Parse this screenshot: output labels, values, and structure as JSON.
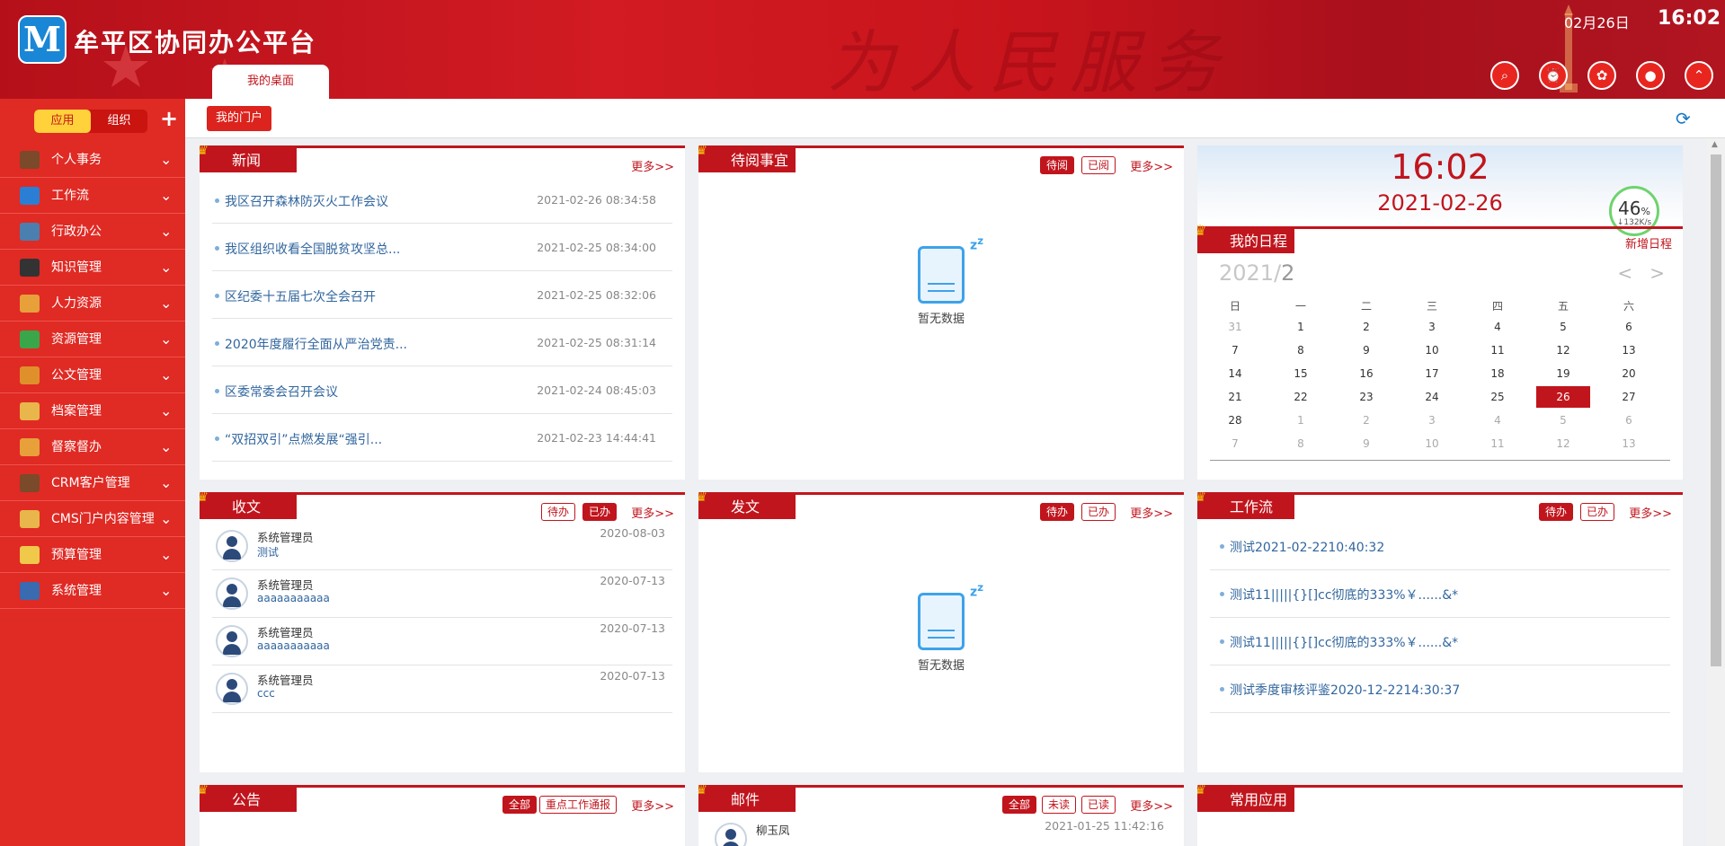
{
  "header": {
    "logo_letter": "M",
    "app_title": "牟平区协同办公平台",
    "tab_label": "我的桌面",
    "background_text": "为人民服务",
    "date": "02月26日",
    "time": "16:02",
    "buttons": [
      "search-icon",
      "alarm-icon",
      "skin-icon",
      "user-icon",
      "collapse-icon"
    ]
  },
  "sidebar": {
    "seg_apps": "应用",
    "seg_org": "组织",
    "add": "+",
    "items": [
      {
        "label": "个人事务",
        "icon": "person-icon",
        "color": "#7a4a2a"
      },
      {
        "label": "工作流",
        "icon": "workflow-icon",
        "color": "#2a7fd4"
      },
      {
        "label": "行政办公",
        "icon": "printer-icon",
        "color": "#4a7fb0"
      },
      {
        "label": "知识管理",
        "icon": "graduation-cap-icon",
        "color": "#333"
      },
      {
        "label": "人力资源",
        "icon": "hr-icon",
        "color": "#e8a03a"
      },
      {
        "label": "资源管理",
        "icon": "layers-icon",
        "color": "#3aa64a"
      },
      {
        "label": "公文管理",
        "icon": "briefcase-icon",
        "color": "#e0902a"
      },
      {
        "label": "档案管理",
        "icon": "folder-icon",
        "color": "#e8b64a"
      },
      {
        "label": "督察督办",
        "icon": "clipboard-icon",
        "color": "#e8a03a"
      },
      {
        "label": "CRM客户管理",
        "icon": "customer-icon",
        "color": "#7a4a2a"
      },
      {
        "label": "CMS门户内容管理",
        "icon": "cms-icon",
        "color": "#e8b64a"
      },
      {
        "label": "预算管理",
        "icon": "notepad-icon",
        "color": "#f0c84a"
      },
      {
        "label": "系统管理",
        "icon": "monitor-icon",
        "color": "#3a6ab0"
      }
    ]
  },
  "toolbar": {
    "portal_button": "我的门户"
  },
  "panels": {
    "news": {
      "title": "新闻",
      "more": "更多>>",
      "rows": [
        {
          "title": "我区召开森林防灭火工作会议",
          "date": "2021-02-26   08:34:58"
        },
        {
          "title": "我区组织收看全国脱贫攻坚总...",
          "date": "2021-02-25   08:34:00"
        },
        {
          "title": "区纪委十五届七次全会召开",
          "date": "2021-02-25   08:32:06"
        },
        {
          "title": "2020年度履行全面从严治党责...",
          "date": "2021-02-25   08:31:14"
        },
        {
          "title": "区委常委会召开会议",
          "date": "2021-02-24   08:45:03"
        },
        {
          "title": "“双招双引”点燃发展“强引...",
          "date": "2021-02-23   14:44:41"
        }
      ]
    },
    "pending": {
      "title": "待阅事宜",
      "tab_a": "待阅",
      "tab_b": "已阅",
      "more": "更多>>",
      "empty": "暂无数据"
    },
    "calendar": {
      "time": "16:02",
      "date": "2021-02-26",
      "gauge_pct": "46",
      "gauge_unit": "%",
      "gauge_speed": "↓132K/s",
      "title": "我的日程",
      "new_schedule": "新增日程",
      "year": "2021/",
      "month": "2",
      "weekdays": [
        "日",
        "一",
        "二",
        "三",
        "四",
        "五",
        "六"
      ],
      "weeks": [
        [
          "31",
          "1",
          "2",
          "3",
          "4",
          "5",
          "6"
        ],
        [
          "7",
          "8",
          "9",
          "10",
          "11",
          "12",
          "13"
        ],
        [
          "14",
          "15",
          "16",
          "17",
          "18",
          "19",
          "20"
        ],
        [
          "21",
          "22",
          "23",
          "24",
          "25",
          "26",
          "27"
        ],
        [
          "28",
          "1",
          "2",
          "3",
          "4",
          "5",
          "6"
        ],
        [
          "7",
          "8",
          "9",
          "10",
          "11",
          "12",
          "13"
        ]
      ],
      "selected_day": "26"
    },
    "received": {
      "title": "收文",
      "tab_a": "待办",
      "tab_b": "已办",
      "more": "更多>>",
      "rows": [
        {
          "name": "系统管理员",
          "subject": "测试",
          "date": "2020-08-03"
        },
        {
          "name": "系统管理员",
          "subject": "aaaaaaaaaaa",
          "date": "2020-07-13"
        },
        {
          "name": "系统管理员",
          "subject": "aaaaaaaaaaa",
          "date": "2020-07-13"
        },
        {
          "name": "系统管理员",
          "subject": "ccc",
          "date": "2020-07-13"
        }
      ]
    },
    "sent": {
      "title": "发文",
      "tab_a": "待办",
      "tab_b": "已办",
      "more": "更多>>",
      "empty": "暂无数据"
    },
    "workflow": {
      "title": "工作流",
      "tab_a": "待办",
      "tab_b": "已办",
      "more": "更多>>",
      "rows": [
        "测试2021-02-2210:40:32",
        "测试11|||||{}[]cc彻底的333%￥......&*",
        "测试11|||||{}[]cc彻底的333%￥......&*",
        "测试季度审核评鉴2020-12-2214:30:37"
      ]
    },
    "notice": {
      "title": "公告",
      "tab_a": "全部",
      "tab_b": "重点工作通报",
      "more": "更多>>"
    },
    "mail": {
      "title": "邮件",
      "tab_a": "全部",
      "tab_b": "未读",
      "tab_c": "已读",
      "more": "更多>>",
      "first_name": "柳玉凤",
      "first_date": "2021-01-25   11:42:16"
    },
    "apps": {
      "title": "常用应用"
    }
  }
}
